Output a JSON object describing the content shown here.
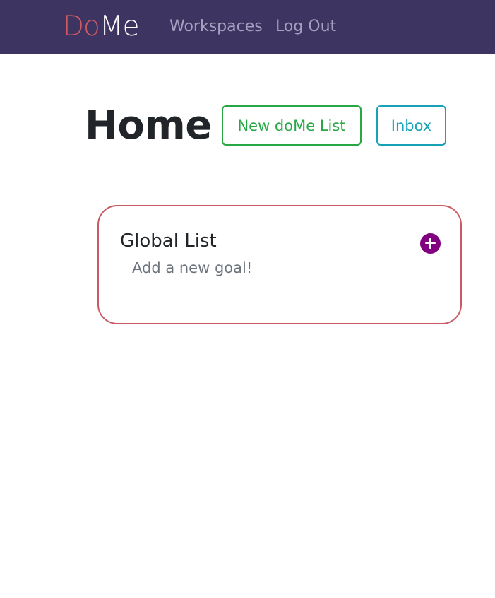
{
  "navbar": {
    "brand_part1": "Do",
    "brand_part2": "Me",
    "links": [
      "Workspaces",
      "Log Out"
    ]
  },
  "main": {
    "title": "Home",
    "new_list_button": "New doMe List",
    "inbox_button": "Inbox"
  },
  "lists": [
    {
      "title": "Global List",
      "placeholder": "Add a new goal!",
      "add_icon": "plus-circle-icon"
    }
  ],
  "colors": {
    "navbar_bg": "#3d3461",
    "brand_accent": "#d05a63",
    "new_list_green": "#28a745",
    "inbox_teal": "#17a2b8",
    "card_border": "#c95a62",
    "add_button_purple": "#800080"
  }
}
